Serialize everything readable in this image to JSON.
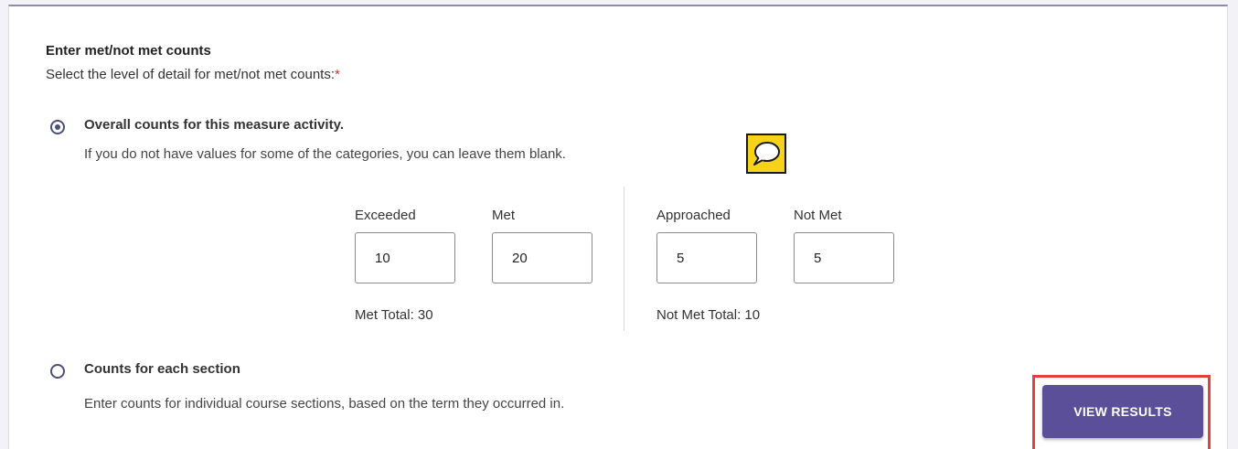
{
  "section": {
    "heading": "Enter met/not met counts",
    "prompt": "Select the level of detail for met/not met counts:",
    "required_marker": "*"
  },
  "options": {
    "overall": {
      "label": "Overall counts for this measure activity.",
      "hint": "If you do not have values for some of the categories, you can leave them blank.",
      "selected": true
    },
    "by_section": {
      "label": "Counts for each section",
      "description": "Enter counts for individual course sections, based on the term they occurred in.",
      "selected": false
    }
  },
  "counts": {
    "exceeded": {
      "label": "Exceeded",
      "value": "10"
    },
    "met": {
      "label": "Met",
      "value": "20"
    },
    "approached": {
      "label": "Approached",
      "value": "5"
    },
    "not_met": {
      "label": "Not Met",
      "value": "5"
    }
  },
  "totals": {
    "met_total": "Met Total:  30",
    "not_met_total": "Not Met Total:  10"
  },
  "actions": {
    "view_results": "VIEW RESULTS"
  },
  "icons": {
    "comment": "speech-bubble-icon"
  },
  "colors": {
    "accent": "#5b4f9a",
    "highlight": "#e0433f",
    "comment_bg": "#f7d21b"
  }
}
